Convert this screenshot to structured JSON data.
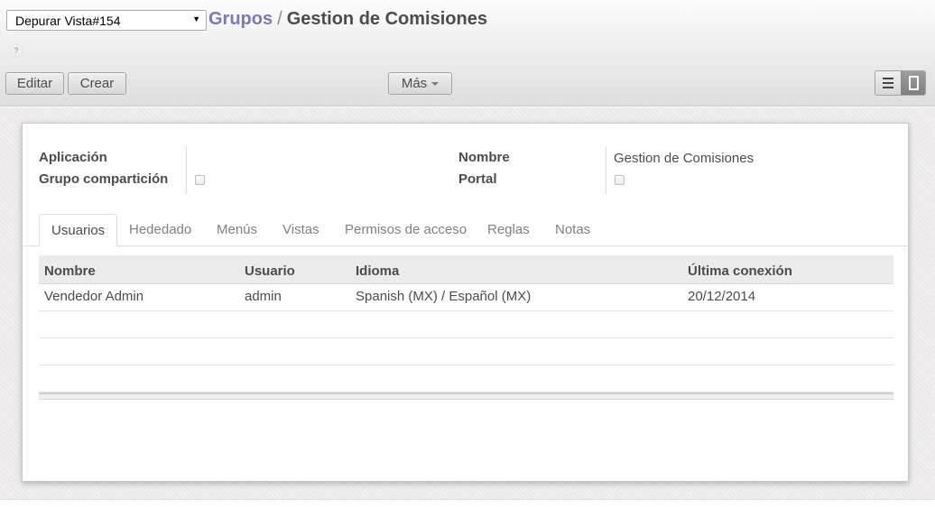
{
  "debug": {
    "selected": "Depurar Vista#154"
  },
  "breadcrumb": {
    "parent": "Grupos",
    "separator": "/",
    "current": "Gestion de Comisiones"
  },
  "help": {
    "symbol": "?"
  },
  "toolbar": {
    "edit_label": "Editar",
    "create_label": "Crear",
    "more_label": "Más"
  },
  "view_switcher": {
    "active": "form",
    "icons": [
      "list-icon",
      "form-icon"
    ]
  },
  "form": {
    "application_label": "Aplicación",
    "application_value": "",
    "share_group_label": "Grupo compartición",
    "share_group_checked": false,
    "name_label": "Nombre",
    "name_value": "Gestion de Comisiones",
    "portal_label": "Portal",
    "portal_checked": false
  },
  "tabs": [
    {
      "label": "Usuarios",
      "active": true
    },
    {
      "label": "Hededado",
      "active": false
    },
    {
      "label": "Menús",
      "active": false
    },
    {
      "label": "Vistas",
      "active": false
    },
    {
      "label": "Permisos de acceso",
      "active": false
    },
    {
      "label": "Reglas",
      "active": false
    },
    {
      "label": "Notas",
      "active": false
    }
  ],
  "users_table": {
    "columns": [
      "Nombre",
      "Usuario",
      "Idioma",
      "Última conexión"
    ],
    "rows": [
      [
        "Vendedor Admin",
        "admin",
        "Spanish (MX) / Español (MX)",
        "20/12/2014"
      ]
    ]
  }
}
